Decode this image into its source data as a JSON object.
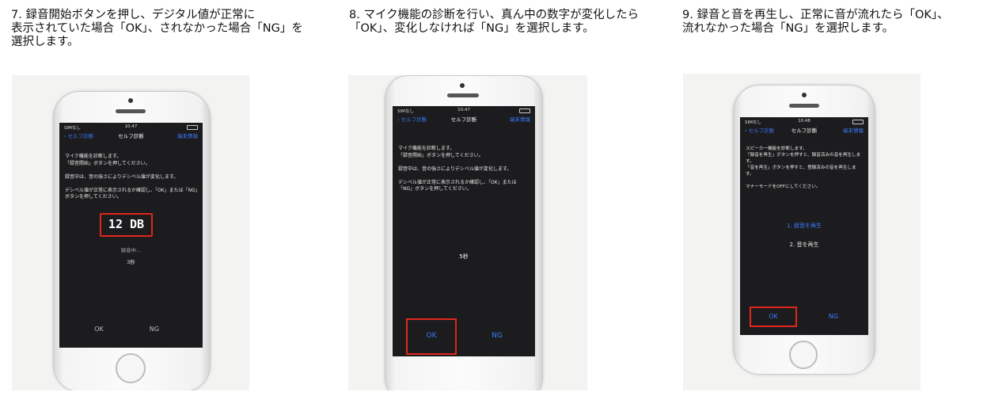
{
  "steps": [
    {
      "caption": "7. 録音開始ボタンを押し、デジタル値が正常に\n表示されていた場合「OK」、されなかった場合「NG」を\n選択します。",
      "status": {
        "carrier": "SIMなし",
        "time": "10:47"
      },
      "nav": {
        "back": "セルフ診断",
        "title": "セルフ診断",
        "right": "端末情報"
      },
      "body": "マイク機能を診断します。\n「録音開始」ボタンを押してください。\n\n録音中は、音の強さによりデシベル値が変化します。\n\nデシベル値が正常に表示されるか確認し、「OK」または「NG」ボタンを押してください。",
      "db_value": "12 DB",
      "recording": "録音中...",
      "timer": "3秒",
      "ok": "OK",
      "ng": "NG"
    },
    {
      "caption": "8. マイク機能の診断を行い、真ん中の数字が変化したら\n「OK」、変化しなければ「NG」を選択します。",
      "status": {
        "carrier": "SIMなし",
        "time": "10:47"
      },
      "nav": {
        "back": "セルフ診断",
        "title": "セルフ診断",
        "right": "端末情報"
      },
      "body": "マイク機能を診断します。\n「録音開始」ボタンを押してください。\n\n録音中は、音の強さによりデシベル値が変化します。\n\nデシベル値が正常に表示されるか確認し、「OK」または「NG」ボタンを押してください。",
      "timer": "5秒",
      "ok": "OK",
      "ng": "NG"
    },
    {
      "caption": "9. 録音と音を再生し、正常に音が流れたら「OK」、\n流れなかった場合「NG」を選択します。",
      "status": {
        "carrier": "SIMなし",
        "time": "10:48"
      },
      "nav": {
        "back": "セルフ診断",
        "title": "セルフ診断",
        "right": "端末情報"
      },
      "body": "スピーカー機能を診断します。\n「録音を再生」ボタンを押すと、録音済みの音を再生します。\n「音を再生」ボタンを押すと、登録済みの音を再生します。\n\nマナーモードをOFFにしてください。",
      "play_recording": "1. 録音を再生",
      "play_sound": "2. 音を再生",
      "ok": "OK",
      "ng": "NG"
    }
  ],
  "colors": {
    "accent": "#3a7bff",
    "highlight": "#e0261d",
    "screen": "#1c1c1e"
  }
}
